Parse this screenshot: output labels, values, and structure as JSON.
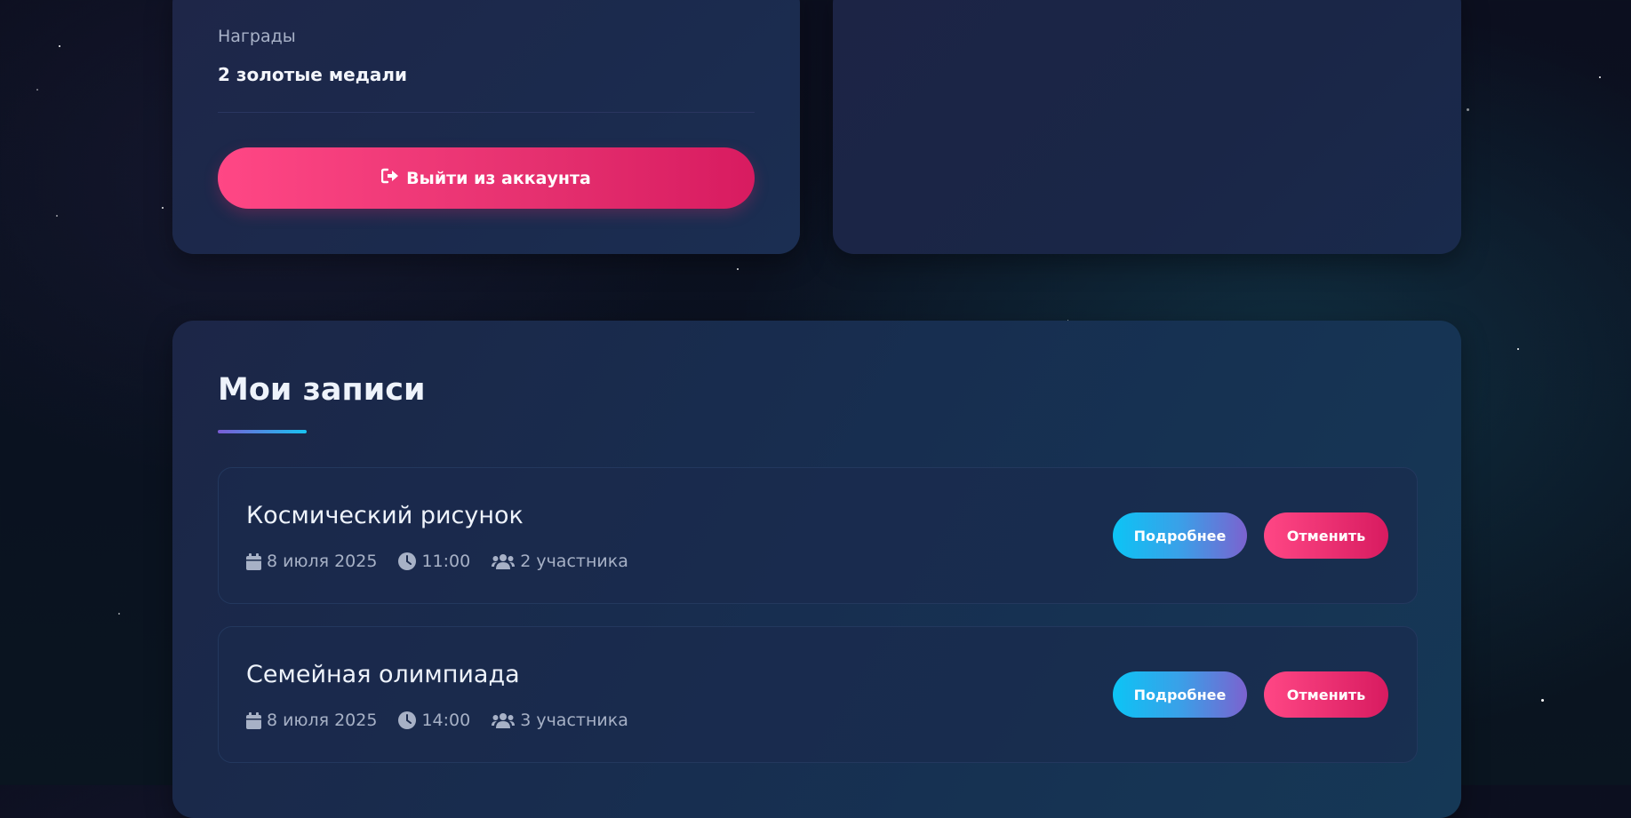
{
  "profile": {
    "awards_label": "Награды",
    "awards_value": "2 золотые медали",
    "logout_label": "Выйти из аккаунта"
  },
  "bookings": {
    "title": "Мои записи",
    "items": [
      {
        "title": "Космический рисунок",
        "date": "8 июля 2025",
        "time": "11:00",
        "participants": "2 участника",
        "details_label": "Подробнее",
        "cancel_label": "Отменить"
      },
      {
        "title": "Семейная олимпиада",
        "date": "8 июля 2025",
        "time": "14:00",
        "participants": "3 участника",
        "details_label": "Подробнее",
        "cancel_label": "Отменить"
      }
    ]
  },
  "colors": {
    "accent_pink": "#e5306f",
    "accent_cyan": "#0cc4f5",
    "accent_purple": "#7b62cf"
  },
  "icons": {
    "logout": "sign-out-icon",
    "date": "calendar-icon",
    "time": "clock-icon",
    "participants": "users-icon"
  }
}
